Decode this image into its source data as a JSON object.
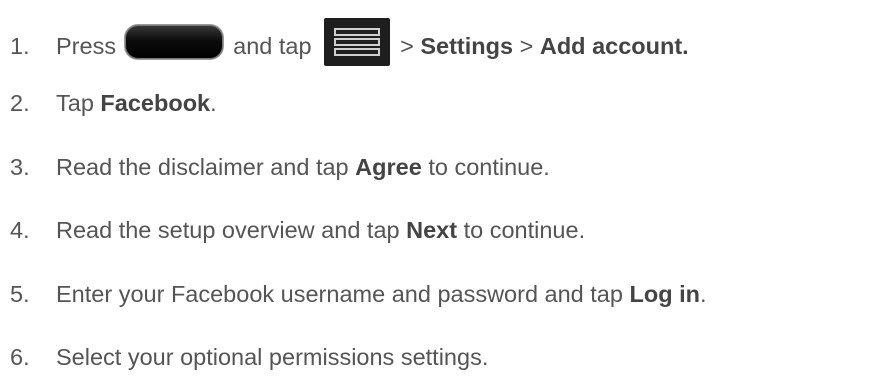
{
  "steps": [
    {
      "number": "1.",
      "parts": {
        "press": "Press",
        "and_tap": "and tap",
        "sep1": ">",
        "settings": "Settings",
        "sep2": ">",
        "add_account": "Add account."
      },
      "icons": [
        "home-key-icon",
        "menu-key-icon"
      ]
    },
    {
      "number": "2.",
      "parts": {
        "tap": "Tap",
        "facebook": "Facebook",
        "end": "."
      }
    },
    {
      "number": "3.",
      "parts": {
        "pre": "Read the disclaimer and tap",
        "agree": "Agree",
        "post": "to continue."
      }
    },
    {
      "number": "4.",
      "parts": {
        "pre": "Read the setup overview and tap",
        "next": "Next",
        "post": "to continue."
      }
    },
    {
      "number": "5.",
      "parts": {
        "pre": "Enter your Facebook username and password and tap",
        "login": "Log in",
        "end": "."
      }
    },
    {
      "number": "6.",
      "parts": {
        "text": "Select your optional permissions settings."
      }
    }
  ]
}
